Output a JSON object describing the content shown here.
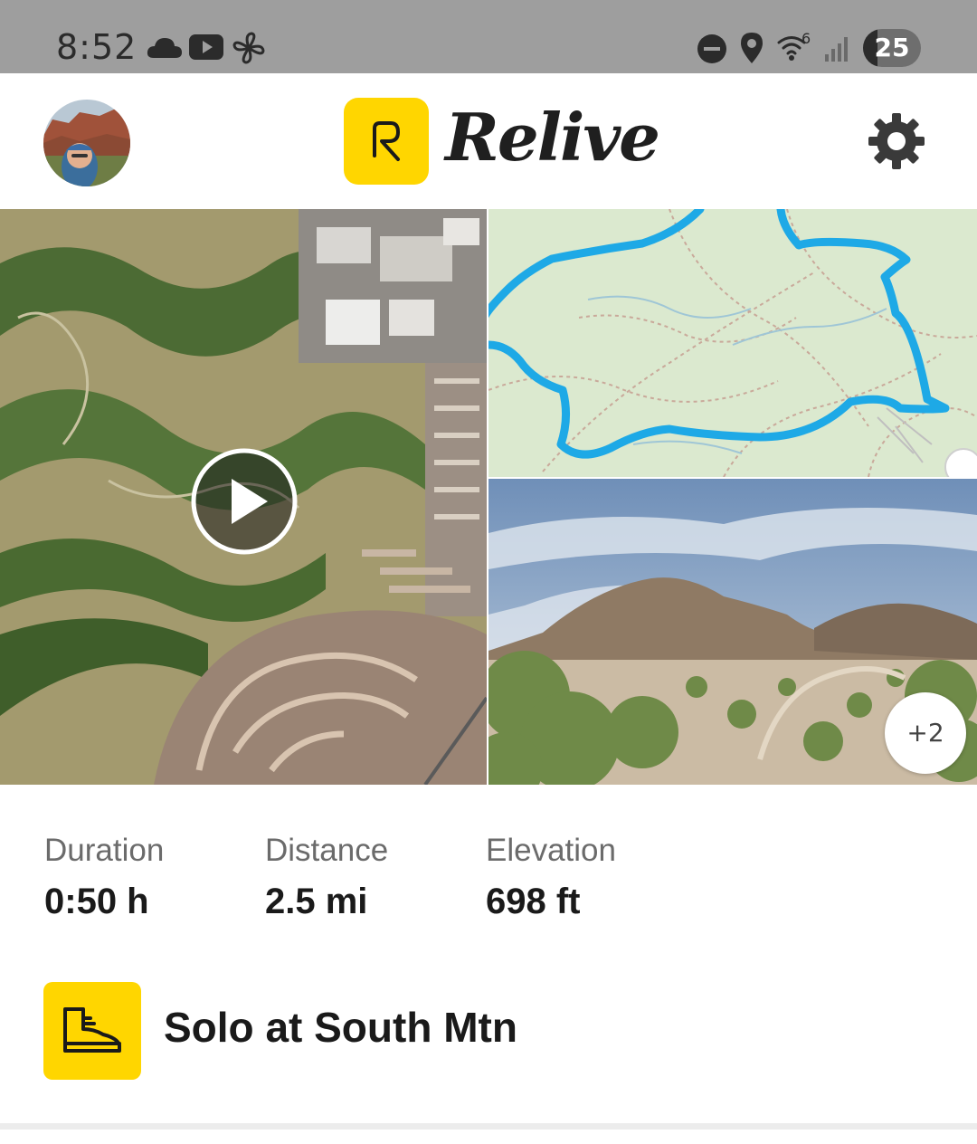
{
  "status_bar": {
    "time": "8:52",
    "icons": [
      "cloud-icon",
      "youtube-icon",
      "fan-icon",
      "dnd-icon",
      "location-icon",
      "wifi-icon",
      "signal-icon"
    ],
    "wifi_label": "6",
    "battery_level": "25",
    "battery_fill_fraction": 0.25
  },
  "header": {
    "logo_text": "Relive",
    "icons": [
      "avatar",
      "relive-logo-icon",
      "gear-icon"
    ],
    "accent_color": "#ffd600"
  },
  "media": {
    "icons": [
      "play-icon"
    ],
    "more_photos_label": "+2",
    "route_color": "#1ea9e6"
  },
  "stats": [
    {
      "label": "Duration",
      "value": "0:50 h"
    },
    {
      "label": "Distance",
      "value": "2.5 mi"
    },
    {
      "label": "Elevation",
      "value": "698 ft"
    }
  ],
  "activity": {
    "icon": "hiking-boot-icon",
    "title": "Solo at South Mtn"
  }
}
